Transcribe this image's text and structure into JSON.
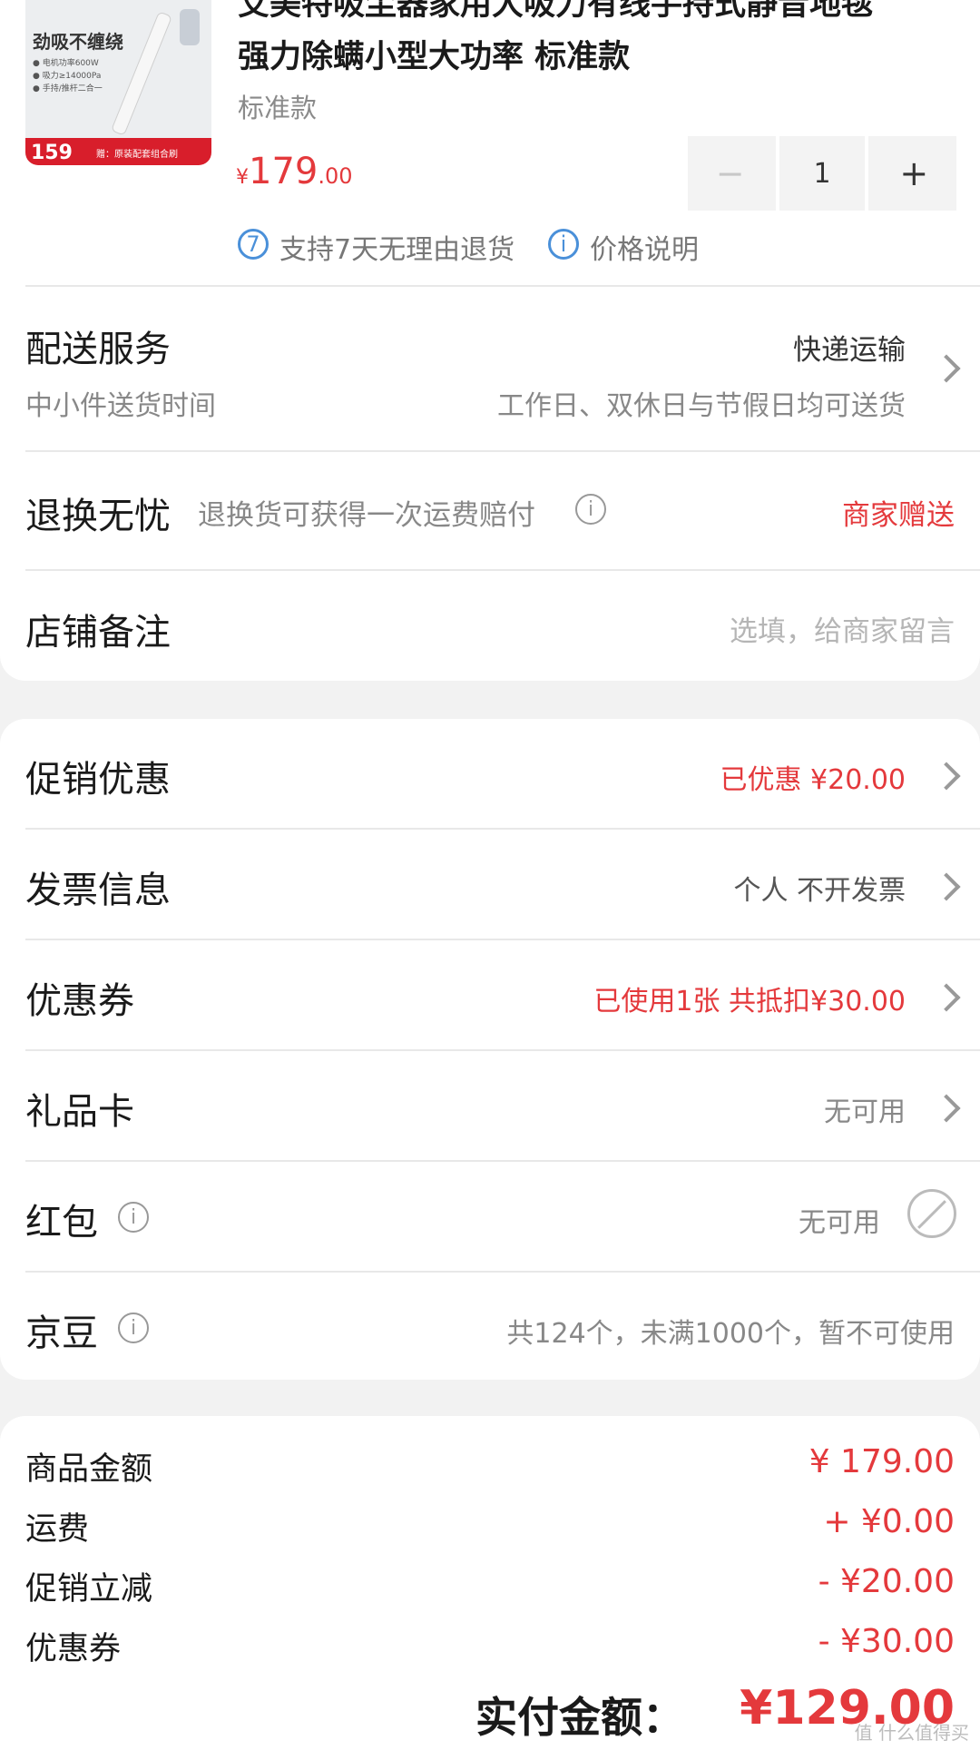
{
  "product": {
    "image": {
      "headline": "劲吸不缠绕",
      "specs": [
        "● 电机功率600W",
        "● 吸力≥14000Pa",
        "● 手持/推杆二合一"
      ],
      "badge_price": "159",
      "badge_tag": "到手价",
      "gift_text": "赠：原装配套组合刷"
    },
    "title_line1": "艾美特吸尘器家用大吸力有线手持式静音地毯",
    "title_line2": "强力除螨小型大功率 标准款",
    "spec": "标准款",
    "price": {
      "currency": "¥",
      "integer": "179",
      "decimal": ".00"
    },
    "quantity": "1",
    "minus_label": "−",
    "plus_label": "+",
    "service_badge": "7",
    "service_text": "支持7天无理由退货",
    "price_note_icon": "i",
    "price_note_text": "价格说明"
  },
  "delivery": {
    "label": "配送服务",
    "method": "快递运输",
    "sub_label": "中小件送货时间",
    "sub_value": "工作日、双休日与节假日均可送货"
  },
  "returns": {
    "label": "退换无忧",
    "desc": "退换货可获得一次运费赔付",
    "value": "商家赠送"
  },
  "remark": {
    "label": "店铺备注",
    "placeholder": "选填，给商家留言"
  },
  "options": {
    "promotion": {
      "label": "促销优惠",
      "value": "已优惠 ¥20.00"
    },
    "invoice": {
      "label": "发票信息",
      "value": "个人 不开发票"
    },
    "coupon": {
      "label": "优惠券",
      "value": "已使用1张 共抵扣¥30.00"
    },
    "giftcard": {
      "label": "礼品卡",
      "value": "无可用"
    },
    "redpacket": {
      "label": "红包",
      "value": "无可用"
    },
    "jingdou": {
      "label": "京豆",
      "value": "共124个，未满1000个，暂不可使用"
    }
  },
  "summary": {
    "rows": [
      {
        "label": "商品金额",
        "value": "¥ 179.00"
      },
      {
        "label": "运费",
        "value": "+ ¥0.00"
      },
      {
        "label": "促销立减",
        "value": "- ¥20.00"
      },
      {
        "label": "优惠券",
        "value": "- ¥30.00"
      }
    ],
    "total_label": "实付金额：",
    "total_value": "¥129.00"
  },
  "watermark": "值 什么值得买",
  "colors": {
    "accent": "#e4393c",
    "info_blue": "#4a90d9",
    "background": "#f2f2f2"
  }
}
